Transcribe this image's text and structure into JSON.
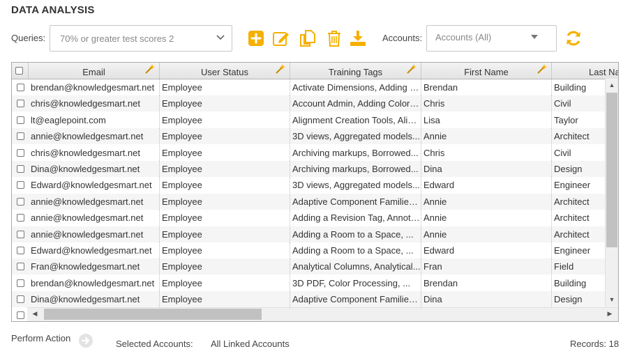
{
  "page": {
    "title": "DATA ANALYSIS"
  },
  "toolbar": {
    "queries_label": "Queries:",
    "query_value": "70% or greater test scores 2",
    "accounts_label": "Accounts:",
    "accounts_value": "Accounts (All)",
    "icons": [
      "add-icon",
      "edit-icon",
      "copy-icon",
      "delete-icon",
      "download-icon",
      "refresh-icon"
    ],
    "accent_color": "#f5b000"
  },
  "grid": {
    "columns": [
      "Email",
      "User Status",
      "Training Tags",
      "First Name",
      "Last Name"
    ],
    "rows": [
      [
        "brendan@knowledgesmart.net",
        "Employee",
        "Activate Dimensions, Adding a...",
        "Brendan",
        "Building"
      ],
      [
        "chris@knowledgesmart.net",
        "Employee",
        "Account Admin, Adding Colors...",
        "Chris",
        "Civil"
      ],
      [
        "lt@eaglepoint.com",
        "Employee",
        "Alignment Creation Tools, Align...",
        "Lisa",
        "Taylor"
      ],
      [
        "annie@knowledgesmart.net",
        "Employee",
        "3D views, Aggregated models...",
        "Annie",
        "Architect"
      ],
      [
        "chris@knowledgesmart.net",
        "Employee",
        "Archiving markups, Borrowed...",
        "Chris",
        "Civil"
      ],
      [
        "Dina@knowledgesmart.net",
        "Employee",
        "Archiving markups, Borrowed...",
        "Dina",
        "Design"
      ],
      [
        "Edward@knowledgesmart.net",
        "Employee",
        "3D views, Aggregated models...",
        "Edward",
        "Engineer"
      ],
      [
        "annie@knowledgesmart.net",
        "Employee",
        "Adaptive Component Families...",
        "Annie",
        "Architect"
      ],
      [
        "annie@knowledgesmart.net",
        "Employee",
        "Adding a Revision Tag, Annota...",
        "Annie",
        "Architect"
      ],
      [
        "annie@knowledgesmart.net",
        "Employee",
        "Adding a Room to a Space, ...",
        "Annie",
        "Architect"
      ],
      [
        "Edward@knowledgesmart.net",
        "Employee",
        "Adding a Room to a Space, ...",
        "Edward",
        "Engineer"
      ],
      [
        "Fran@knowledgesmart.net",
        "Employee",
        "Analytical Columns, Analytical...",
        "Fran",
        "Field"
      ],
      [
        "brendan@knowledgesmart.net",
        "Employee",
        "3D PDF, Color Processing, ...",
        "Brendan",
        "Building"
      ],
      [
        "Dina@knowledgesmart.net",
        "Employee",
        "Adaptive Component Families...",
        "Dina",
        "Design"
      ]
    ]
  },
  "footer": {
    "perform_action": "Perform Action",
    "selected_accounts_label": "Selected Accounts:",
    "selected_accounts_value": "All Linked Accounts",
    "records": "Records: 18"
  }
}
